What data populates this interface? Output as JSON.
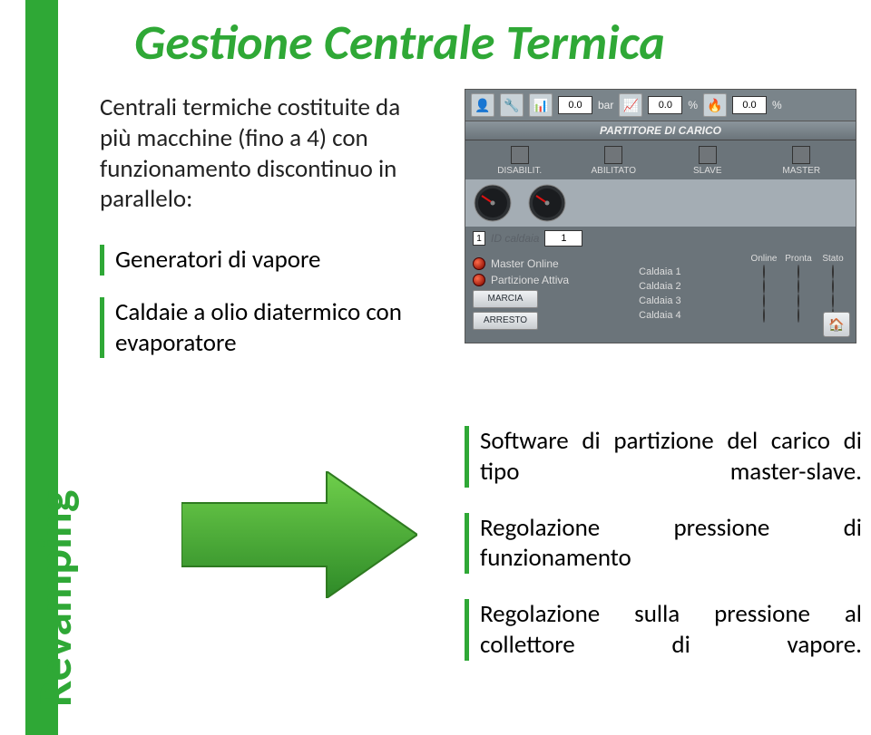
{
  "sidebar": {
    "label": "Revamping"
  },
  "title": "Gestione Centrale Termica",
  "intro": "Centrali termiche costituite da più macchine (fino a 4) con funzionamento discontinuo in parallelo:",
  "bullets": [
    "Generatori di vapore",
    "Caldaie a olio diatermico con evaporatore"
  ],
  "right_bullets": [
    "Software di partizione del carico di tipo master-slave.",
    "Regolazione pressione di funzionamento",
    "Regolazione sulla pressione al collettore di vapore."
  ],
  "hmi": {
    "top": {
      "val1": "0.0",
      "unit1": "bar",
      "val2": "0.0",
      "unit2": "%",
      "val3": "0.0",
      "unit3": "%"
    },
    "strip": "PARTITORE DI CARICO",
    "modes": [
      "DISABILIT.",
      "ABILITATO",
      "SLAVE",
      "MASTER"
    ],
    "id_caldaia_label": "ID caldaia",
    "id_caldaia_value": "1",
    "index_one": "1",
    "status_leds": [
      "Master Online",
      "Partizione Attiva"
    ],
    "buttons": [
      "MARCIA",
      "ARRESTO"
    ],
    "table_headers": [
      "Online",
      "Pronta",
      "Stato"
    ],
    "caldaie": [
      "Caldaia 1",
      "Caldaia 2",
      "Caldaia 3",
      "Caldaia 4"
    ]
  }
}
